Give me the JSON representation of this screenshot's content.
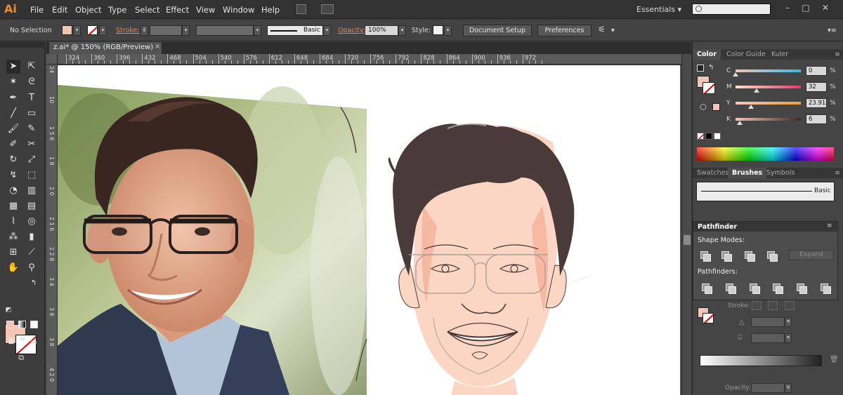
{
  "app": {
    "logo_text": "Ai"
  },
  "menu": [
    "File",
    "Edit",
    "Object",
    "Type",
    "Select",
    "Effect",
    "View",
    "Window",
    "Help"
  ],
  "workspace": {
    "label": "Essentials",
    "caret": "▾"
  },
  "controlbar": {
    "selection": "No Selection",
    "stroke_label": "Stroke:",
    "brush": "Basic",
    "opacity_label": "Opacity:",
    "opacity_value": "100%",
    "style_label": "Style:",
    "doc_setup": "Document Setup",
    "preferences": "Preferences"
  },
  "document": {
    "tab_title": "z.ai* @ 150% (RGB/Preview)",
    "close": "×"
  },
  "ruler": {
    "h_ticks": [
      "324",
      "360",
      "396",
      "432",
      "468",
      "504",
      "540",
      "576",
      "612",
      "648",
      "684",
      "720",
      "756",
      "792",
      "828",
      "864",
      "900",
      "936",
      "972"
    ],
    "v_ticks": [
      "24",
      "10",
      "1 5 6",
      "1 8",
      "2 0",
      "2 1 6",
      "2 2 8",
      "3 4",
      "3 6",
      "3 8",
      "4 2 0"
    ]
  },
  "color_panel": {
    "tabs": [
      "Color",
      "Color Guide",
      "Kuler"
    ],
    "channels": [
      {
        "label": "C",
        "value": "0",
        "level": 0.0
      },
      {
        "label": "M",
        "value": "32",
        "level": 0.32
      },
      {
        "label": "Y",
        "value": "23.91",
        "level": 0.2391
      },
      {
        "label": "K",
        "value": "6",
        "level": 0.06
      }
    ],
    "unit": "%",
    "fill_color": "#f4c4b5"
  },
  "brushes_panel": {
    "tabs": [
      "Swatches",
      "Brushes",
      "Symbols"
    ],
    "brush_name": "Basic"
  },
  "pathfinder": {
    "title": "Pathfinder",
    "shape_modes": "Shape Modes:",
    "pathfinders": "Pathfinders:",
    "expand": "Expand"
  },
  "appearance": {
    "stroke_label": "Stroke:",
    "opacity_label": "Opacity:"
  },
  "colors": {
    "accent_orange": "#ee8a27",
    "skin": "#fcd6c4",
    "hair": "#4a3a3a"
  }
}
